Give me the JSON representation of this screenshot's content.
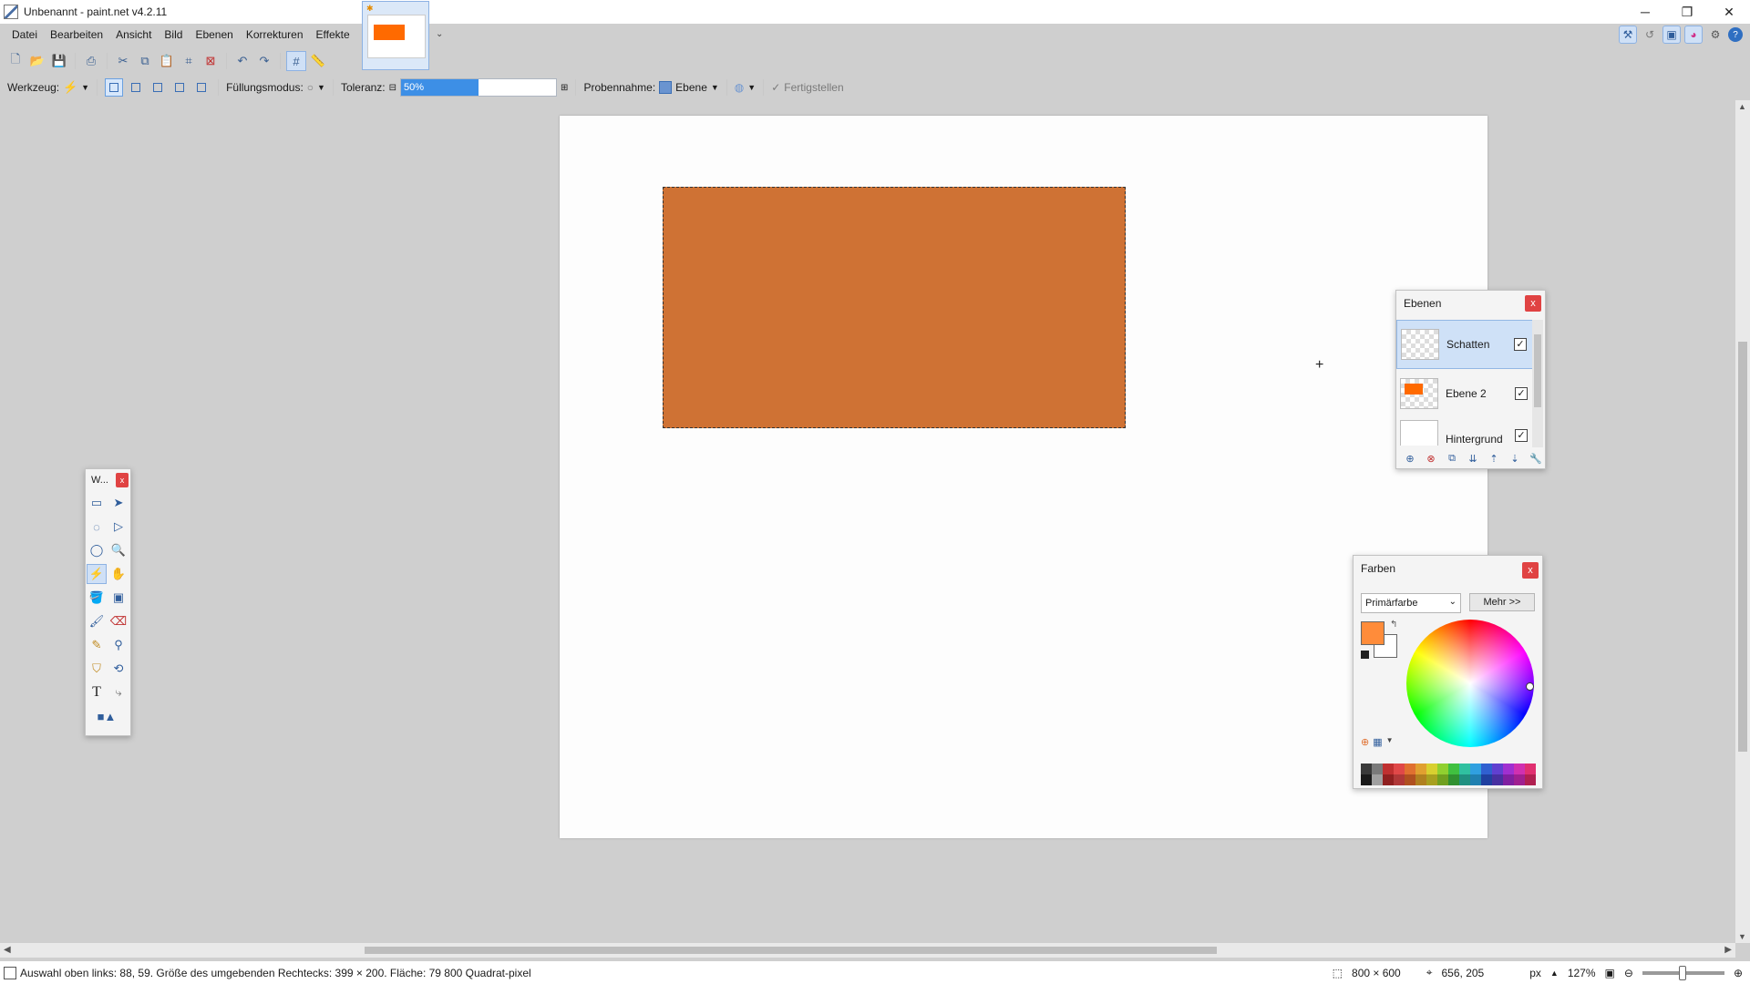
{
  "window": {
    "title": "Unbenannt - paint.net v4.2.11",
    "controls": [
      "─",
      "❐",
      "✕"
    ]
  },
  "menu": [
    "Datei",
    "Bearbeiten",
    "Ansicht",
    "Bild",
    "Ebenen",
    "Korrekturen",
    "Effekte"
  ],
  "tool_options": {
    "werkzeug_label": "Werkzeug:",
    "fuellmodus_label": "Füllungsmodus:",
    "toleranz_label": "Toleranz:",
    "toleranz_value": "50%",
    "toleranz_fraction": 0.5,
    "probennahme_label": "Probennahme:",
    "probennahme_value": "Ebene",
    "fertigstellen": "Fertigstellen"
  },
  "canvas": {
    "rect_color": "#cf7234"
  },
  "tools_window": {
    "title": "W...",
    "close": "x"
  },
  "layers_window": {
    "title": "Ebenen",
    "close": "x",
    "layers": [
      {
        "name": "Schatten",
        "checked": "✓"
      },
      {
        "name": "Ebene 2",
        "checked": "✓"
      },
      {
        "name": "Hintergrund",
        "checked": "✓"
      }
    ]
  },
  "colors_window": {
    "title": "Farben",
    "close": "x",
    "select_value": "Primärfarbe",
    "more_button": "Mehr >>",
    "primary_color": "#ff8c3a",
    "secondary_color": "#ffffff"
  },
  "statusbar": {
    "selection_info": "Auswahl oben links: 88, 59. Größe des umgebenden Rechtecks: 399 × 200. Fläche: 79 800 Quadrat-pixel",
    "image_size": "800 × 600",
    "cursor_pos": "656, 205",
    "unit": "px",
    "zoom": "127%"
  },
  "palette_colors": [
    "#3a3a3a",
    "#7a7a7a",
    "#c03030",
    "#e04848",
    "#e07030",
    "#e0a030",
    "#d8d030",
    "#90d030",
    "#40c040",
    "#30c0a0",
    "#30a0e0",
    "#3060d0",
    "#6040d0",
    "#a030d0",
    "#d030b0",
    "#e03070",
    "#1a1a1a",
    "#a0a0a0",
    "#902020",
    "#b03838",
    "#b05020",
    "#b08020",
    "#a8a020",
    "#70a020",
    "#309030",
    "#209080",
    "#2080b0",
    "#2040a0",
    "#4830a0",
    "#8020a0",
    "#a02090",
    "#b02050"
  ]
}
